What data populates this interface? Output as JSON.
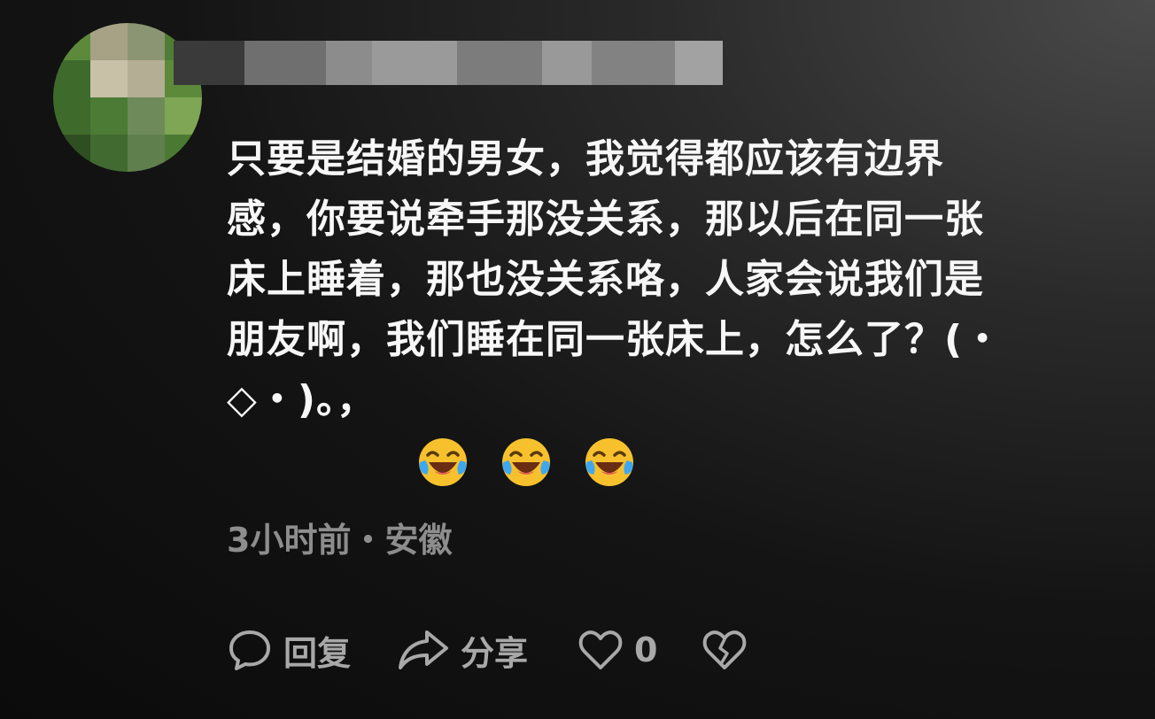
{
  "comment": {
    "text": "只要是结婚的男女，我觉得都应该有边界感，你要说牵手那没关系，那以后在同一张床上睡着，那也没关系咯，人家会说我们是朋友啊，我们睡在同一张床上，怎么了？(・◇・)。，",
    "text_lines": [
      "只要是结婚的男女，我觉得都应该有边界",
      "感，你要说牵手那没关系，那以后在同一张",
      "床上睡着，那也没关系咯，人家会说我们是",
      "朋友啊，我们睡在同一张床上，怎么了？(・",
      "◇・)。，"
    ],
    "emojis": [
      "laughing-tears-emoji",
      "laughing-tears-emoji",
      "laughing-tears-emoji"
    ],
    "meta": "3小时前・安徽"
  },
  "actions": {
    "reply_label": "回复",
    "share_label": "分享",
    "like_count": "0"
  },
  "icons": {
    "reply": "speech-bubble-icon",
    "share": "share-arrow-icon",
    "like": "heart-icon",
    "dislike": "broken-heart-icon"
  },
  "colors": {
    "background": "#0b0b0b",
    "text": "#f7f7f7",
    "meta_text": "#8d8d8d",
    "action_text": "#a8a8a8",
    "emoji_yellow": "#f7c12e",
    "emoji_tear": "#3fa7ee"
  }
}
